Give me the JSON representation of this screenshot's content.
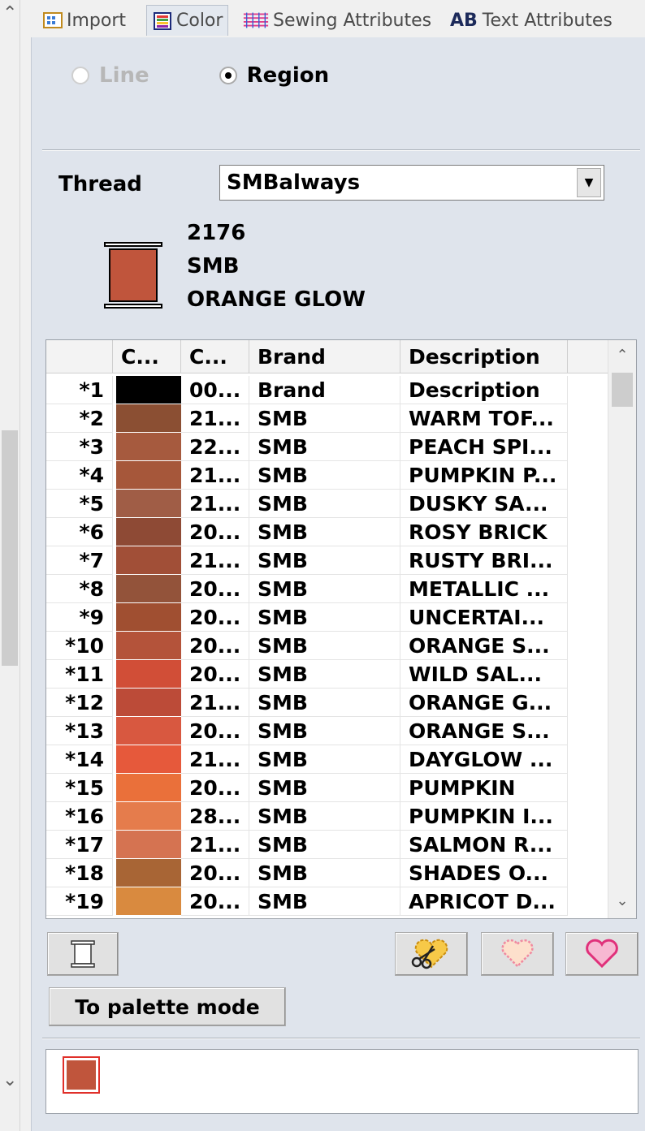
{
  "tabs": [
    {
      "label": "Import",
      "icon": "import-grid-icon",
      "active": false
    },
    {
      "label": "Color",
      "icon": "color-palette-icon",
      "active": true
    },
    {
      "label": "Sewing Attributes",
      "icon": "sewing-stitch-icon",
      "active": false
    },
    {
      "label": "Text Attributes",
      "icon": "text-ab-icon",
      "active": false,
      "icon_text": "AB"
    }
  ],
  "mode": {
    "line_label": "Line",
    "line_enabled": false,
    "region_label": "Region",
    "selected": "Region"
  },
  "thread": {
    "label": "Thread",
    "selected": "SMBalways"
  },
  "current_color": {
    "code": "2176",
    "brand": "SMB",
    "description": "ORANGE GLOW",
    "hex": "#c0553c"
  },
  "table": {
    "headers": [
      "",
      "C...",
      "C...",
      "Brand",
      "Description"
    ],
    "rows": [
      {
        "index": "*1",
        "color": "#000000",
        "code": "00...",
        "brand": "Brand",
        "description": "Description"
      },
      {
        "index": "*2",
        "color": "#8b4f33",
        "code": "21...",
        "brand": "SMB",
        "description": "WARM TOF..."
      },
      {
        "index": "*3",
        "color": "#a65a3e",
        "code": "22...",
        "brand": "SMB",
        "description": "PEACH SPI..."
      },
      {
        "index": "*4",
        "color": "#a6573a",
        "code": "21...",
        "brand": "SMB",
        "description": "PUMPKIN P..."
      },
      {
        "index": "*5",
        "color": "#a05d46",
        "code": "21...",
        "brand": "SMB",
        "description": "DUSKY SA..."
      },
      {
        "index": "*6",
        "color": "#8e4a35",
        "code": "20...",
        "brand": "SMB",
        "description": "ROSY BRICK"
      },
      {
        "index": "*7",
        "color": "#a14f37",
        "code": "21...",
        "brand": "SMB",
        "description": "RUSTY BRI..."
      },
      {
        "index": "*8",
        "color": "#93533a",
        "code": "20...",
        "brand": "SMB",
        "description": "METALLIC ..."
      },
      {
        "index": "*9",
        "color": "#a04f31",
        "code": "20...",
        "brand": "SMB",
        "description": "UNCERTAI..."
      },
      {
        "index": "*10",
        "color": "#b4533a",
        "code": "20...",
        "brand": "SMB",
        "description": "ORANGE S..."
      },
      {
        "index": "*11",
        "color": "#d14e37",
        "code": "20...",
        "brand": "SMB",
        "description": "WILD SAL..."
      },
      {
        "index": "*12",
        "color": "#bc4b38",
        "code": "21...",
        "brand": "SMB",
        "description": "ORANGE G..."
      },
      {
        "index": "*13",
        "color": "#d85840",
        "code": "20...",
        "brand": "SMB",
        "description": "ORANGE S..."
      },
      {
        "index": "*14",
        "color": "#e6593b",
        "code": "21...",
        "brand": "SMB",
        "description": "DAYGLOW ..."
      },
      {
        "index": "*15",
        "color": "#ea703a",
        "code": "20...",
        "brand": "SMB",
        "description": "PUMPKIN"
      },
      {
        "index": "*16",
        "color": "#e57c4c",
        "code": "28...",
        "brand": "SMB",
        "description": "PUMPKIN I..."
      },
      {
        "index": "*17",
        "color": "#d57351",
        "code": "21...",
        "brand": "SMB",
        "description": "SALMON R..."
      },
      {
        "index": "*18",
        "color": "#a86535",
        "code": "20...",
        "brand": "SMB",
        "description": "SHADES O..."
      },
      {
        "index": "*19",
        "color": "#d98a3f",
        "code": "20...",
        "brand": "SMB",
        "description": "APRICOT D..."
      }
    ]
  },
  "buttons": {
    "thread_spool_icon": "thread-spool-icon",
    "cut_heart_icon": "scissors-heart-icon",
    "heart_light_icon": "heart-outline-icon",
    "heart_pink_icon": "heart-pink-icon",
    "palette_mode_label": "To palette mode"
  },
  "palette_preview": {
    "color": "#c0553c"
  }
}
